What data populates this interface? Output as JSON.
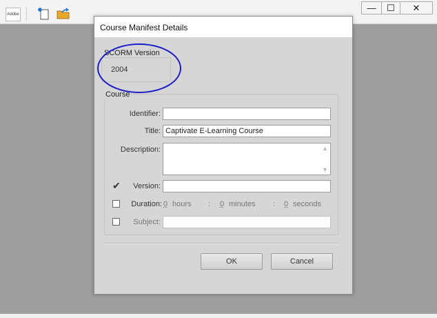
{
  "host": {
    "logo_text": "Adobe",
    "window_buttons": {
      "minimize": "—",
      "maximize": "☐",
      "close": "✕"
    },
    "toolbar_icons": [
      "new-document-icon",
      "open-folder-icon"
    ]
  },
  "dialog": {
    "title": "Course Manifest Details",
    "scorm": {
      "legend": "SCORM Version",
      "value": "2004"
    },
    "course": {
      "legend": "Course",
      "identifier_label": "Identifier:",
      "identifier_value": "",
      "title_label": "Title:",
      "title_value": "Captivate E-Learning Course",
      "description_label": "Description:",
      "description_value": "",
      "version_label": "Version:",
      "version_checked": true,
      "version_value": "",
      "duration_label": "Duration:",
      "duration_checked": false,
      "hours_value": "0",
      "hours_label": "hours",
      "minutes_value": "0",
      "minutes_label": "minutes",
      "seconds_value": "0",
      "seconds_label": "seconds",
      "colon": ":",
      "subject_label": "Subject:",
      "subject_checked": false,
      "subject_value": ""
    },
    "buttons": {
      "ok": "OK",
      "cancel": "Cancel"
    }
  },
  "colors": {
    "annotation": "#1a1ac8",
    "backdrop": "#9e9e9e",
    "dialog": "#d6d6d6"
  }
}
